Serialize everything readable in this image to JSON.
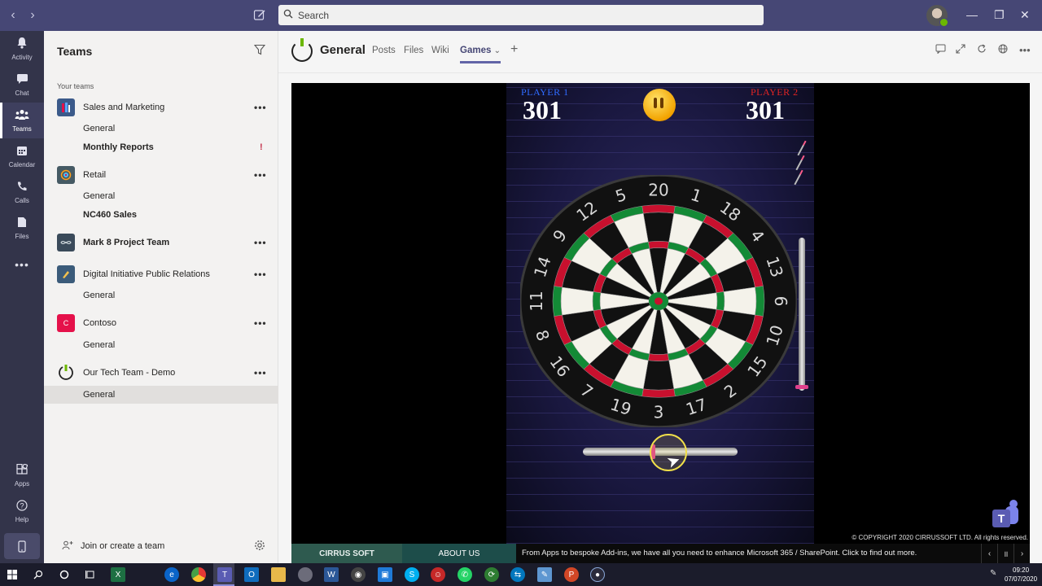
{
  "titlebar": {
    "search_placeholder": "Search",
    "win_minimize": "—",
    "win_restore": "❐",
    "win_close": "✕"
  },
  "rail": {
    "items": [
      {
        "label": "Activity",
        "icon": "bell-icon"
      },
      {
        "label": "Chat",
        "icon": "chat-icon"
      },
      {
        "label": "Teams",
        "icon": "teams-icon"
      },
      {
        "label": "Calendar",
        "icon": "calendar-icon"
      },
      {
        "label": "Calls",
        "icon": "phone-icon"
      },
      {
        "label": "Files",
        "icon": "file-icon"
      }
    ],
    "more": "•••",
    "apps": "Apps",
    "help": "Help"
  },
  "panel": {
    "title": "Teams",
    "section": "Your teams",
    "teams": [
      {
        "name": "Sales and Marketing",
        "logo_color": "#3b5a8a",
        "channels": [
          {
            "label": "General",
            "bold": false
          },
          {
            "label": "Monthly Reports",
            "bold": true,
            "alert": "!"
          }
        ]
      },
      {
        "name": "Retail",
        "logo_color": "#455a64",
        "channels": [
          {
            "label": "General",
            "bold": false
          },
          {
            "label": "NC460 Sales",
            "bold": true
          }
        ]
      },
      {
        "name": "Mark 8 Project Team",
        "logo_color": "#3a4a5a",
        "bold": true,
        "channels": []
      },
      {
        "name": "Digital Initiative Public Relations",
        "logo_color": "#3b5b7a",
        "channels": [
          {
            "label": "General",
            "bold": false
          }
        ]
      },
      {
        "name": "Contoso",
        "logo_color": "#e5114a",
        "logo_text": "C",
        "channels": [
          {
            "label": "General",
            "bold": false
          }
        ]
      },
      {
        "name": "Our Tech Team - Demo",
        "logo_color": "#ffffff",
        "channels": [
          {
            "label": "General",
            "bold": false,
            "selected": true
          }
        ]
      }
    ],
    "more": "•••",
    "join": "Join or create a team"
  },
  "channel": {
    "name": "General",
    "tabs": [
      "Posts",
      "Files",
      "Wiki",
      "Games"
    ],
    "active_tab": "Games",
    "games_chevron": "⌄",
    "add": "+"
  },
  "game": {
    "player1_label": "PLAYER 1",
    "player1_score": "301",
    "player2_label": "PLAYER 2",
    "player2_score": "301",
    "player1_color": "#2f6bff",
    "player2_color": "#e02424",
    "board_numbers": [
      "20",
      "1",
      "18",
      "4",
      "13",
      "6",
      "10",
      "15",
      "2",
      "17",
      "3",
      "19",
      "7",
      "16",
      "8",
      "11",
      "14",
      "9",
      "12",
      "5"
    ],
    "copyright": "© COPYRIGHT 2020 CIRRUSSOFT LTD. All rights reserved.",
    "darts_remaining": 3
  },
  "bottom_bar": {
    "button1": "CIRRUS SOFT",
    "button2": "ABOUT US",
    "ticker": "From Apps to bespoke Add-ins, we have all you need to enhance Microsoft 365 / SharePoint. Click to find out more.",
    "prev": "‹",
    "pause": "॥",
    "next": "›"
  },
  "taskbar": {
    "time": "09:20",
    "date": "07/07/2020"
  }
}
